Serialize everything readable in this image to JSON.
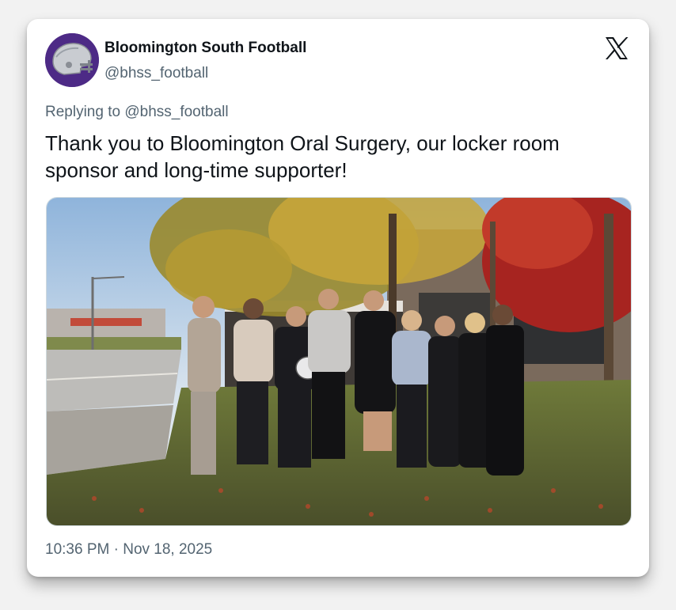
{
  "author": {
    "name": "Bloomington South Football",
    "handle": "@bhss_football",
    "avatar_icon": "football-helmet-icon",
    "avatar_color": "#4d2a86"
  },
  "brand": {
    "logo_icon": "x-logo-icon"
  },
  "reply": {
    "prefix": "Replying to",
    "handle": "@bhss_football"
  },
  "tweet": {
    "text": "Thank you to Bloomington Oral Surgery, our locker room sponsor and long-time supporter!"
  },
  "media": {
    "kind": "photo"
  },
  "meta": {
    "time": "10:36 PM",
    "separator": "·",
    "date": "Nov 18, 2025"
  },
  "colors": {
    "text_primary": "#0f1419",
    "text_secondary": "#536471",
    "border": "#cfd9de"
  }
}
